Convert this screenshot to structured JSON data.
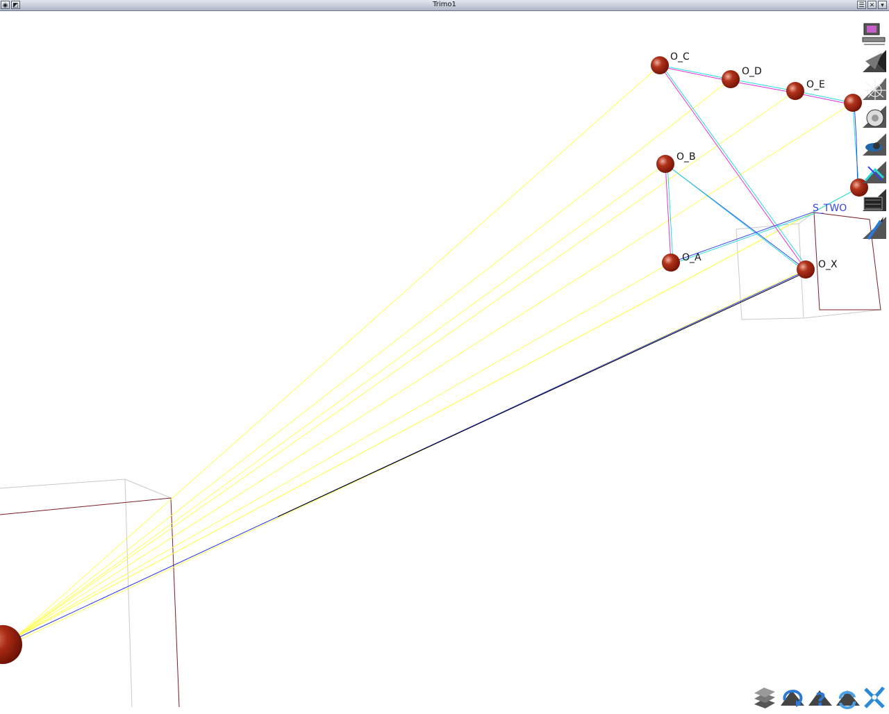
{
  "window": {
    "title": "Trimo1",
    "left_buttons": [
      "window-menu-icon",
      "restore-icon"
    ],
    "right_buttons": [
      "menu-icon",
      "close-icon",
      "minimize-icon"
    ]
  },
  "scene": {
    "nodes": [
      {
        "id": "o_c",
        "label": "O_C"
      },
      {
        "id": "o_d",
        "label": "O_D"
      },
      {
        "id": "o_e",
        "label": "O_E"
      },
      {
        "id": "o_b",
        "label": "O_B"
      },
      {
        "id": "o_a",
        "label": "O_A"
      },
      {
        "id": "o_x",
        "label": "O_X"
      }
    ],
    "sensor_label": "S_TWO",
    "colors": {
      "sphere": "#8b1a0a",
      "ray": "#ffff55",
      "link_magenta": "#e02ee0",
      "link_cyan": "#22dddd",
      "link_blue": "#3344ee",
      "box_red": "#7a1b24",
      "box_grey": "#c9c9c9"
    }
  },
  "toolbar_right": {
    "tools": [
      "monitor-tool-icon",
      "pyramid-tool-icon",
      "mesh-tool-icon",
      "lens-tool-icon",
      "camera-tool-icon",
      "link-tool-icon",
      "film-tool-icon",
      "pen-tool-icon"
    ]
  },
  "toolbar_bottom": {
    "tools": [
      "layers-icon",
      "rotate-icon",
      "help-icon",
      "refresh-icon",
      "exit-icon"
    ]
  }
}
